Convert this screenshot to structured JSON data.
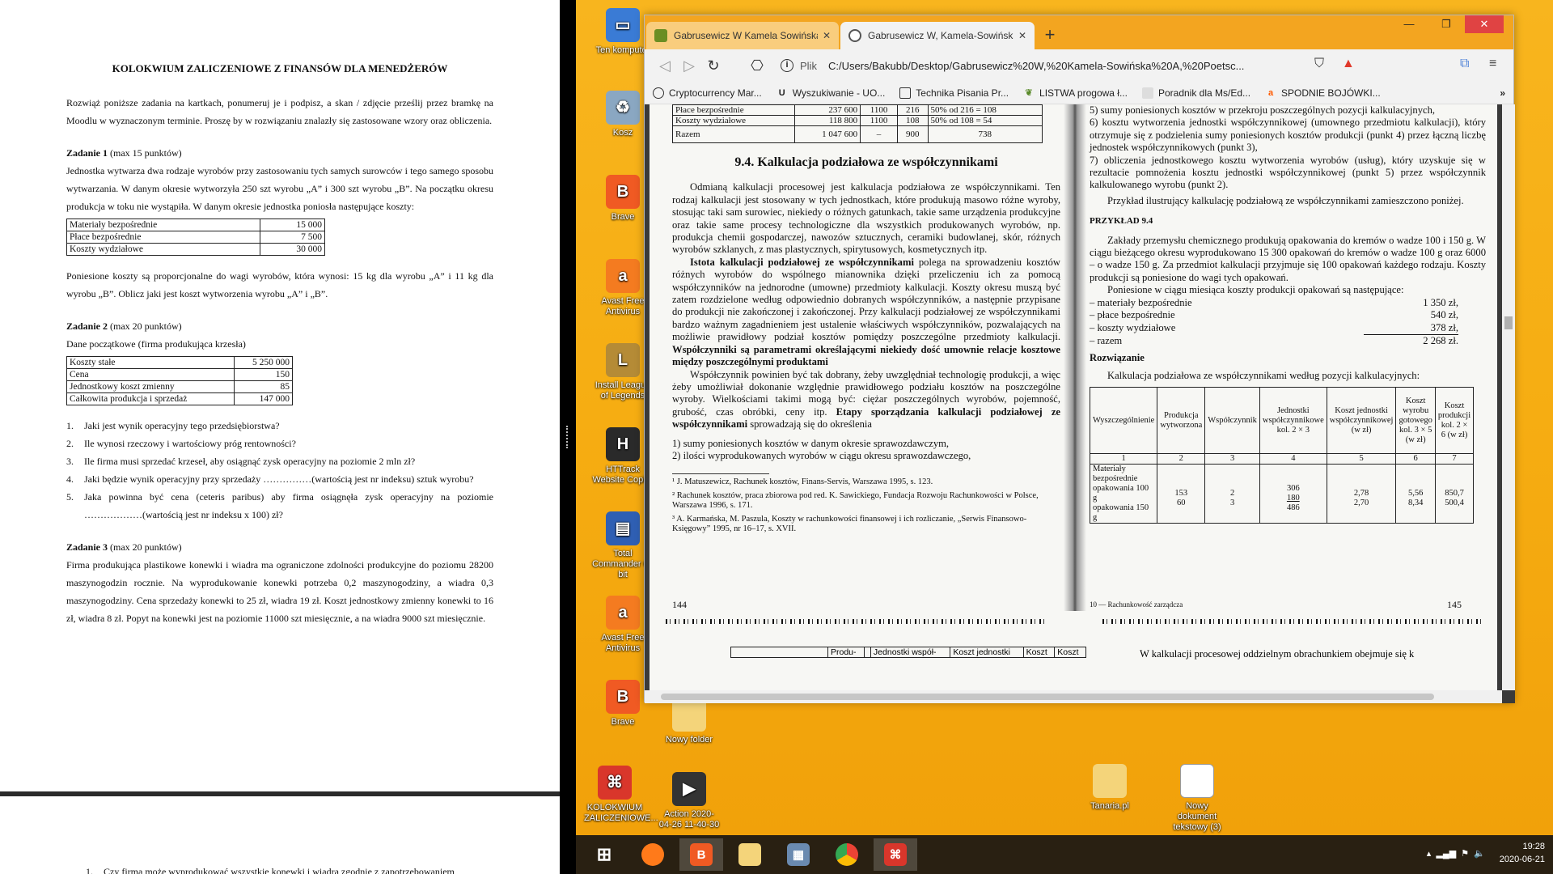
{
  "document": {
    "title": "KOLOKWIUM ZALICZENIOWE Z FINANSÓW DLA MENEDŻERÓW",
    "intro": "Rozwiąż poniższe zadania na kartkach, ponumeruj je i podpisz, a skan / zdjęcie prześlij przez bramkę na Moodlu w wyznaczonym terminie. Proszę by w rozwiązaniu znalazły się zastosowane wzory oraz obliczenia.",
    "task1": {
      "heading": "Zadanie 1",
      "points": "(max 15 punktów)",
      "text": "Jednostka wytwarza dwa rodzaje wyrobów przy zastosowaniu tych samych surowców i tego samego sposobu wytwarzania. W danym okresie wytworzyła 250 szt wyrobu „A” i 300 szt wyrobu „B”. Na początku okresu produkcja w toku nie wystąpiła. W danym okresie jednostka poniosła następujące koszty:",
      "rows": [
        {
          "label": "Materiały bezpośrednie",
          "value": "15 000"
        },
        {
          "label": "Płace bezpośrednie",
          "value": "7 500"
        },
        {
          "label": "Koszty wydziałowe",
          "value": "30 000"
        }
      ],
      "after": "Poniesione koszty są proporcjonalne do wagi wyrobów, która wynosi: 15 kg dla wyrobu „A” i 11 kg dla wyrobu „B”. Oblicz jaki jest koszt wytworzenia wyrobu „A” i „B”."
    },
    "task2": {
      "heading": "Zadanie 2",
      "points": "(max 20 punktów)",
      "subtitle": "Dane początkowe (firma produkująca krzesła)",
      "rows": [
        {
          "label": "Koszty stałe",
          "value": "5 250 000"
        },
        {
          "label": "Cena",
          "value": "150"
        },
        {
          "label": "Jednostkowy koszt zmienny",
          "value": "85"
        },
        {
          "label": "Całkowita produkcja i sprzedaż",
          "value": "147 000"
        }
      ],
      "questions": [
        {
          "n": "1.",
          "t": "Jaki jest wynik operacyjny tego przedsiębiorstwa?"
        },
        {
          "n": "2.",
          "t": "Ile wynosi rzeczowy i wartościowy próg rentowności?"
        },
        {
          "n": "3.",
          "t": "Ile firma musi sprzedać krzeseł, aby osiągnąć zysk operacyjny na poziomie 2 mln zł?"
        },
        {
          "n": "4.",
          "t": "Jaki będzie wynik operacyjny przy sprzedaży ……………(wartością jest nr indeksu) sztuk wyrobu?"
        },
        {
          "n": "5.",
          "t": "Jaka powinna być cena (ceteris paribus) aby firma osiągnęła zysk operacyjny na poziomie ………………(wartością jest nr indeksu x 100) zł?"
        }
      ]
    },
    "task3": {
      "heading": "Zadanie 3",
      "points": "(max 20 punktów)",
      "text": "Firma produkująca plastikowe konewki i wiadra ma ograniczone zdolności produkcyjne do poziomu 28200 maszynogodzin rocznie. Na wyprodukowanie konewki potrzeba 0,2 maszynogodziny, a wiadra 0,3 maszynogodziny. Cena sprzedaży konewki to 25 zł, wiadra 19 zł. Koszt jednostkowy zmienny konewki to 16 zł, wiadra 8 zł. Popyt na konewki jest na poziomie 11000 szt miesięcznie, a na wiadra 9000 szt miesięcznie."
    },
    "page2_line": {
      "n": "1.",
      "t": "Czy firma może wyprodukować wszystkie konewki i wiadra zgodnie z zapotrzebowaniem"
    }
  },
  "desktop_icons": [
    {
      "label": "Ten komputer",
      "icon": "computer-icon",
      "color": "#3a7bd5"
    },
    {
      "label": "Kosz",
      "icon": "recycle-bin-icon",
      "color": "#8aa7c2"
    },
    {
      "label": "Brave",
      "icon": "brave-icon",
      "color": "#f05a23"
    },
    {
      "label": "Avast Free Antivirus",
      "icon": "avast-icon",
      "color": "#f47b20"
    },
    {
      "label": "Install League of Legends",
      "icon": "league-icon",
      "color": "#b58b36"
    },
    {
      "label": "HTTrack Website Copier",
      "icon": "httrack-icon",
      "color": "#2a2a2a"
    },
    {
      "label": "Total Commander 64 bit",
      "icon": "total-commander-icon",
      "color": "#2f5fb3"
    },
    {
      "label": "Avast Free Antivirus",
      "icon": "avast-icon",
      "color": "#f47b20"
    },
    {
      "label": "Brave",
      "icon": "brave-icon",
      "color": "#f05a23"
    },
    {
      "label": "Nowy folder",
      "icon": "folder-icon",
      "color": "#f4d47a"
    },
    {
      "label": "KOLOKWIUM ZALICZENIOWE...",
      "icon": "pdf-icon",
      "color": "#d9362b"
    },
    {
      "label": "Action 2020-04-26 11-40-30",
      "icon": "video-icon",
      "color": "#333333"
    },
    {
      "label": "Tanaria.pl",
      "icon": "folder-icon",
      "color": "#f4d47a"
    },
    {
      "label": "Nowy dokument tekstowy (3)",
      "icon": "text-file-icon",
      "color": "#ffffff"
    }
  ],
  "browser": {
    "tabs": [
      {
        "title": "Gabrusewicz W Kamela Sowińska A",
        "active": false
      },
      {
        "title": "Gabrusewicz W, Kamela-Sowińska",
        "active": true
      }
    ],
    "address_label": "Plik",
    "url": "C:/Users/Bakubb/Desktop/Gabrusewicz%20W,%20Kamela-Sowińska%20A,%20Poetsc...",
    "bookmarks": [
      {
        "label": "Cryptocurrency Mar...",
        "icon": "cmc-icon"
      },
      {
        "label": "Wyszukiwanie - UO...",
        "icon": "u-icon"
      },
      {
        "label": "Technika Pisania Pr...",
        "icon": "building-icon"
      },
      {
        "label": "LISTWA progowa ł...",
        "icon": "leaf-icon"
      },
      {
        "label": "Poradnik dla Ms/Ed...",
        "icon": "doc-icon"
      },
      {
        "label": "SPODNIE BOJÓWKI...",
        "icon": "allegro-icon"
      }
    ],
    "bookmarks_more": "»"
  },
  "scan": {
    "top_table": [
      {
        "c1": "Płace bezpośrednie",
        "c2": "237 600",
        "c3": "1100",
        "c4": "216",
        "c5": "50% od 216 = 108"
      },
      {
        "c1": "Koszty wydziałowe",
        "c2": "118 800",
        "c3": "1100",
        "c4": "108",
        "c5": "50% od 108 = 54"
      }
    ],
    "top_total": {
      "c1": "Razem",
      "c2": "1 047 600",
      "c3": "–",
      "c4": "900",
      "c5": "738"
    },
    "heading": "9.4. Kalkulacja podziałowa ze współczynnikami",
    "left_p1": "Odmianą kalkulacji procesowej jest kalkulacja podziałowa ze współczynnikami. Ten rodzaj kalkulacji jest stosowany w tych jednostkach, które produkują masowo różne wyroby, stosując taki sam surowiec, niekiedy o różnych gatunkach, takie same urządzenia produkcyjne oraz takie same procesy technologiczne dla wszystkich produkowanych wyrobów, np. produkcja chemii gospodarczej, nawozów sztucznych, ceramiki budowlanej, skór, różnych wyrobów szklanych, z mas plastycznych, spirytusowych, kosmetycznych itp.",
    "left_p2_bold": "Istota kalkulacji podziałowej ze współczynnikami",
    "left_p2": "polega na sprowadzeniu kosztów różnych wyrobów do wspólnego mianownika dzięki przeliczeniu ich za pomocą współczynników na jednorodne (umowne) przedmioty kalkulacji. Koszty okresu muszą być zatem rozdzielone według odpowiednio dobranych współczynników, a następnie przypisane do produkcji nie zakończonej i zakończonej. Przy kalkulacji podziałowej ze współczynnikami bardzo ważnym zagadnieniem jest ustalenie właściwych współczynników, pozwalających na możliwie prawidłowy podział kosztów pomiędzy poszczególne przedmioty kalkulacji.",
    "left_p2_bold2": "Współczynniki są parametrami określającymi niekiedy dość umownie relacje kosztowe między poszczególnymi produktami",
    "left_p3": "Współczynnik powinien być tak dobrany, żeby uwzględniał technologię produkcji, a więc żeby umożliwiał dokonanie względnie prawidłowego podziału kosztów na poszczególne wyroby. Wielkościami takimi mogą być: ciężar poszczególnych wyrobów, pojemność, grubość, czas obróbki, ceny itp.",
    "left_p4_bold": "Etapy sporządzania kalkulacji podziałowej ze współczynnikami",
    "left_p4": "sprowadzają się do określenia",
    "left_list": [
      "1) sumy poniesionych kosztów w danym okresie sprawozdawczym,",
      "2) ilości wyprodukowanych wyrobów w ciągu okresu sprawozdawczego,"
    ],
    "footnotes": [
      "¹ J. Matuszewicz, Rachunek kosztów, Finans-Servis, Warszawa 1995, s. 123.",
      "² Rachunek kosztów, praca zbiorowa pod red. K. Sawickiego, Fundacja Rozwoju Rachunkowości w Polsce, Warszawa 1996, s. 171.",
      "³ A. Karmańska, M. Paszula, Koszty w rachunkowości finansowej i ich rozliczanie, „Serwis Finansowo-Księgowy” 1995, nr 16–17, s. XVII."
    ],
    "page_left": "144",
    "right_list": [
      "5) sumy poniesionych kosztów w przekroju poszczególnych pozycji kalkulacyjnych,",
      "6) kosztu wytworzenia jednostki współczynnikowej (umownego przedmiotu kalkulacji), który otrzymuje się z podzielenia sumy poniesionych kosztów produkcji (punkt 4) przez łączną liczbę jednostek współczynnikowych (punkt 3),",
      "7) obliczenia jednostkowego kosztu wytworzenia wyrobów (usług), który uzyskuje się w rezultacie pomnożenia kosztu jednostki współczynnikowej (punkt 5) przez współczynnik kalkulowanego wyrobu (punkt 2)."
    ],
    "right_p1": "Przykład ilustrujący kalkulację podziałową ze współczynnikami zamieszczono poniżej.",
    "example_heading": "PRZYKŁAD 9.4",
    "right_p2": "Zakłady przemysłu chemicznego produkują opakowania do kremów o wadze 100 i 150 g. W ciągu bieżącego okresu wyprodukowano 15 300 opakowań do kremów o wadze 100 g oraz 6000 – o wadze 150 g. Za przedmiot kalkulacji przyjmuje się 100 opakowań każdego rodzaju. Koszty produkcji są poniesione do wagi tych opakowań.",
    "right_p3": "Poniesione w ciągu miesiąca koszty produkcji opakowań są następujące:",
    "cost_rows": [
      {
        "label": "materiały bezpośrednie",
        "value": "1 350 zł,"
      },
      {
        "label": "płace bezpośrednie",
        "value": "540 zł,"
      },
      {
        "label": "koszty wydziałowe",
        "value": "378 zł,"
      },
      {
        "label": "razem",
        "value": "2 268 zł."
      }
    ],
    "solution_heading": "Rozwiązanie",
    "solution_intro": "Kalkulacja podziałowa ze współczynnikami według pozycji kalkulacyjnych:",
    "calc_headers": [
      "Wyszczególnienie",
      "Produkcja wytworzona",
      "Współczynnik",
      "Jednostki współczynnikowe kol. 2 × 3",
      "Koszt jednostki współczynnikowej (w zł)",
      "Koszt wyrobu gotowego kol. 3 × 5 (w zł)",
      "Koszt produkcji kol. 2 × 6 (w zł)"
    ],
    "calc_nums": [
      "1",
      "2",
      "3",
      "4",
      "5",
      "6",
      "7"
    ],
    "calc_row_label": "Materiały bezpośrednie",
    "calc_rows": [
      {
        "c1": "opakowania 100 g",
        "c2": "153",
        "c3": "2",
        "c4": "306",
        "c5": "2,78",
        "c6": "5,56",
        "c7": "850,7"
      },
      {
        "c1": "opakowania 150 g",
        "c2": "60",
        "c3": "3",
        "c4": "180",
        "c5": "2,70",
        "c6": "8,34",
        "c7": "500,4"
      }
    ],
    "calc_sum": "486",
    "running_head": "10 — Rachunkowość zarządcza",
    "page_right": "145",
    "bottom_right_text": "W kalkulacji procesowej oddzielnym obrachunkiem obejmuje się k",
    "bottom_table_headers": [
      "Produ-",
      "Jednostki współ-",
      "Koszt jednostki",
      "Koszt",
      "Koszt"
    ]
  },
  "taskbar": {
    "items": [
      {
        "name": "start-button",
        "icon": "windows-icon",
        "color": "#ffffff"
      },
      {
        "name": "firefox",
        "icon": "firefox-icon",
        "color": "#ff7a1a"
      },
      {
        "name": "brave",
        "icon": "brave-icon",
        "color": "#f05a23"
      },
      {
        "name": "explorer",
        "icon": "folder-icon",
        "color": "#f4d47a"
      },
      {
        "name": "calculator",
        "icon": "calculator-icon",
        "color": "#6a8ab0"
      },
      {
        "name": "chrome",
        "icon": "chrome-icon",
        "color": "#34a853"
      },
      {
        "name": "pdf",
        "icon": "pdf-icon",
        "color": "#d9362b"
      }
    ],
    "time": "19:28",
    "date": "2020-06-21"
  }
}
